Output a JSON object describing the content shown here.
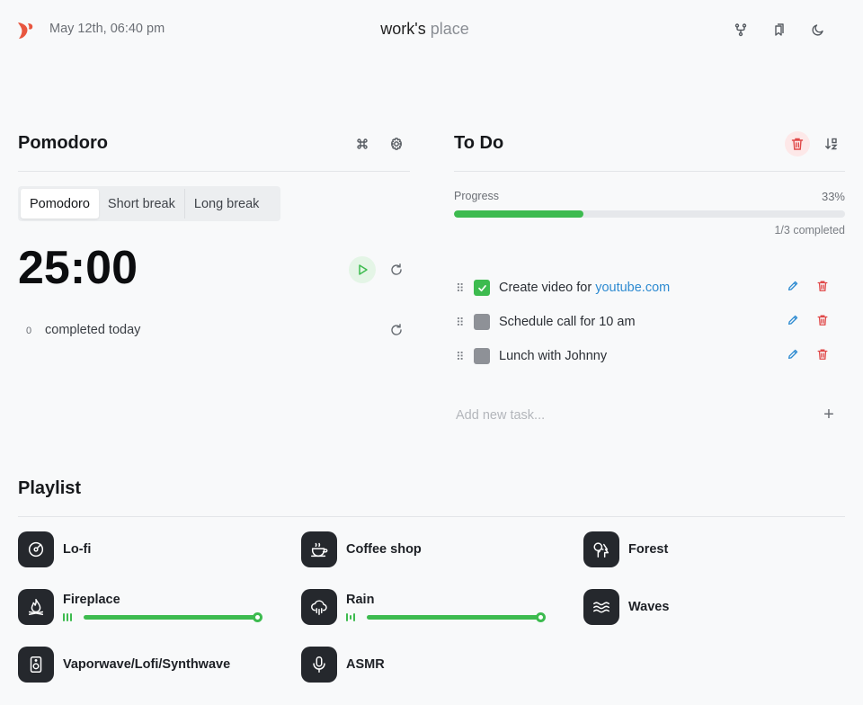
{
  "header": {
    "date": "May 12th, 06:40 pm",
    "title_main": "work's",
    "title_light": "place",
    "icons": [
      "fork-icon",
      "bookmarks-icon",
      "moon-icon"
    ]
  },
  "pomodoro": {
    "title": "Pomodoro",
    "tabs": [
      {
        "label": "Pomodoro",
        "active": true
      },
      {
        "label": "Short break",
        "active": false
      },
      {
        "label": "Long break",
        "active": false
      }
    ],
    "timer": "25:00",
    "completed_count": "0",
    "completed_label": "completed today"
  },
  "todo": {
    "title": "To Do",
    "progress_label": "Progress",
    "progress_percent": "33%",
    "progress_value": 0.33,
    "progress_sub": "1/3 completed",
    "tasks": [
      {
        "text": "Create video for ",
        "link": "youtube.com",
        "done": true
      },
      {
        "text": "Schedule call for 10 am",
        "link": "",
        "done": false
      },
      {
        "text": "Lunch with Johnny",
        "link": "",
        "done": false
      }
    ],
    "new_task_placeholder": "Add new task...",
    "add_symbol": "+"
  },
  "playlist": {
    "title": "Playlist",
    "sounds": [
      {
        "name": "Lo-fi",
        "icon": "vinyl-icon",
        "playing": false
      },
      {
        "name": "Coffee shop",
        "icon": "coffee-icon",
        "playing": false
      },
      {
        "name": "Forest",
        "icon": "trees-icon",
        "playing": false
      },
      {
        "name": "Fireplace",
        "icon": "flame-icon",
        "playing": true,
        "volume": 1.0
      },
      {
        "name": "Rain",
        "icon": "cloud-rain-icon",
        "playing": true,
        "volume": 1.0
      },
      {
        "name": "Waves",
        "icon": "waves-icon",
        "playing": false
      },
      {
        "name": "Vaporwave/Lofi/Synthwave",
        "icon": "speaker-icon",
        "playing": false
      },
      {
        "name": "ASMR",
        "icon": "microphone-icon",
        "playing": false
      }
    ]
  },
  "colors": {
    "accent_green": "#3dbb4f",
    "danger_red": "#e04848",
    "link_blue": "#2e8bd1",
    "logo_red": "#e8563f"
  }
}
